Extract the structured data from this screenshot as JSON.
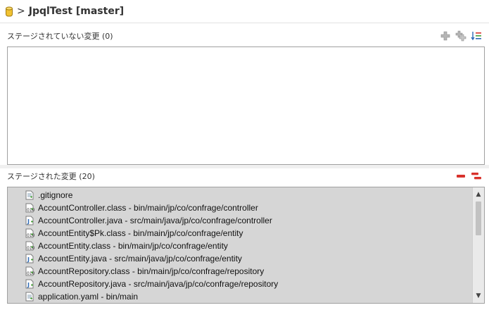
{
  "header": {
    "separator": ">",
    "repo_title": "JpqlTest [master]"
  },
  "unstaged": {
    "label": "ステージされていない変更 (0)",
    "tools": [
      "add-icon",
      "add-all-icon",
      "sort-icon"
    ]
  },
  "staged": {
    "label": "ステージされた変更 (20)",
    "tools": [
      "remove-icon",
      "remove-all-icon"
    ],
    "items": [
      {
        "text": ".gitignore",
        "icon": "text-file-icon"
      },
      {
        "text": "AccountController.class - bin/main/jp/co/confrage/controller",
        "icon": "class-file-icon"
      },
      {
        "text": "AccountController.java - src/main/java/jp/co/confrage/controller",
        "icon": "java-file-icon"
      },
      {
        "text": "AccountEntity$Pk.class - bin/main/jp/co/confrage/entity",
        "icon": "class-file-icon"
      },
      {
        "text": "AccountEntity.class - bin/main/jp/co/confrage/entity",
        "icon": "class-file-icon"
      },
      {
        "text": "AccountEntity.java - src/main/java/jp/co/confrage/entity",
        "icon": "java-file-icon"
      },
      {
        "text": "AccountRepository.class - bin/main/jp/co/confrage/repository",
        "icon": "class-file-icon"
      },
      {
        "text": "AccountRepository.java - src/main/java/jp/co/confrage/repository",
        "icon": "java-file-icon"
      },
      {
        "text": "application.yaml - bin/main",
        "icon": "text-file-icon"
      }
    ]
  },
  "colors": {
    "add_green": "#4aa03c",
    "remove_red": "#d8322c",
    "list_bg": "#d6d6d6"
  }
}
